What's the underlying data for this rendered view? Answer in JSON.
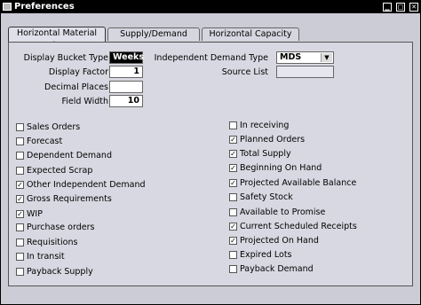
{
  "window": {
    "title": "Preferences"
  },
  "tabs": [
    {
      "label": "Horizontal Material Plan",
      "active": true
    },
    {
      "label": "Supply/Demand",
      "active": false
    },
    {
      "label": "Horizontal Capacity Plan",
      "active": false
    }
  ],
  "fields": {
    "display_bucket_type": {
      "label": "Display Bucket Type",
      "value": "Weeks"
    },
    "display_factor": {
      "label": "Display Factor",
      "value": "1"
    },
    "decimal_places": {
      "label": "Decimal Places",
      "value": ""
    },
    "field_width": {
      "label": "Field Width",
      "value": "10"
    },
    "independent_demand_type": {
      "label": "Independent Demand Type",
      "value": "MDS"
    },
    "source_list": {
      "label": "Source List",
      "value": ""
    }
  },
  "left_checks": [
    {
      "label": "Sales Orders",
      "checked": false
    },
    {
      "label": "Forecast",
      "checked": false
    },
    {
      "label": "Dependent Demand",
      "checked": false
    },
    {
      "label": "Expected Scrap",
      "checked": false
    },
    {
      "label": "Other Independent Demand",
      "checked": true
    },
    {
      "label": "Gross Requirements",
      "checked": true
    },
    {
      "label": "WIP",
      "checked": true
    },
    {
      "label": "Purchase orders",
      "checked": false
    },
    {
      "label": "Requisitions",
      "checked": false
    },
    {
      "label": "In transit",
      "checked": false
    },
    {
      "label": "Payback Supply",
      "checked": false
    }
  ],
  "right_checks": [
    {
      "label": "In receiving",
      "checked": false
    },
    {
      "label": "Planned Orders",
      "checked": true
    },
    {
      "label": "Total Supply",
      "checked": true
    },
    {
      "label": "Beginning On Hand",
      "checked": true
    },
    {
      "label": "Projected Available Balance",
      "checked": true
    },
    {
      "label": "Safety Stock",
      "checked": false
    },
    {
      "label": "Available to Promise",
      "checked": false
    },
    {
      "label": "Current Scheduled Receipts",
      "checked": true
    },
    {
      "label": "Projected On Hand",
      "checked": true
    },
    {
      "label": "Expired Lots",
      "checked": false
    },
    {
      "label": "Payback Demand",
      "checked": false
    }
  ]
}
